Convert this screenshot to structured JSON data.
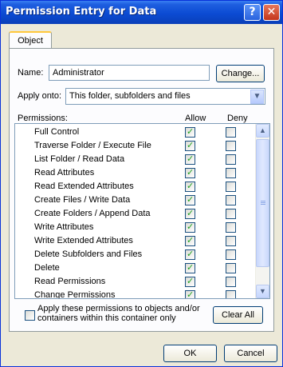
{
  "window": {
    "title": "Permission Entry for Data",
    "help_glyph": "?",
    "close_glyph": "✕"
  },
  "tabs": [
    {
      "label": "Object"
    }
  ],
  "name_row": {
    "label": "Name:",
    "value": "Administrator",
    "change_button": "Change..."
  },
  "apply_onto": {
    "label": "Apply onto:",
    "value": "This folder, subfolders and files"
  },
  "permissions": {
    "header_label": "Permissions:",
    "allow_header": "Allow",
    "deny_header": "Deny",
    "rows": [
      {
        "name": "Full Control",
        "allow": true,
        "deny": false
      },
      {
        "name": "Traverse Folder / Execute File",
        "allow": true,
        "deny": false
      },
      {
        "name": "List Folder / Read Data",
        "allow": true,
        "deny": false
      },
      {
        "name": "Read Attributes",
        "allow": true,
        "deny": false
      },
      {
        "name": "Read Extended Attributes",
        "allow": true,
        "deny": false
      },
      {
        "name": "Create Files / Write Data",
        "allow": true,
        "deny": false
      },
      {
        "name": "Create Folders / Append Data",
        "allow": true,
        "deny": false
      },
      {
        "name": "Write Attributes",
        "allow": true,
        "deny": false
      },
      {
        "name": "Write Extended Attributes",
        "allow": true,
        "deny": false
      },
      {
        "name": "Delete Subfolders and Files",
        "allow": true,
        "deny": false
      },
      {
        "name": "Delete",
        "allow": true,
        "deny": false
      },
      {
        "name": "Read Permissions",
        "allow": true,
        "deny": false
      },
      {
        "name": "Change Permissions",
        "allow": true,
        "deny": false
      }
    ]
  },
  "apply_containers": {
    "line1": "Apply these permissions to objects and/or",
    "line2": "containers within this container only",
    "checked": false
  },
  "buttons": {
    "clear_all": "Clear All",
    "ok": "OK",
    "cancel": "Cancel"
  },
  "icons": {
    "checkmark": "✓",
    "scroll_up": "▲",
    "scroll_down": "▼",
    "combo_arrow": "▼"
  }
}
